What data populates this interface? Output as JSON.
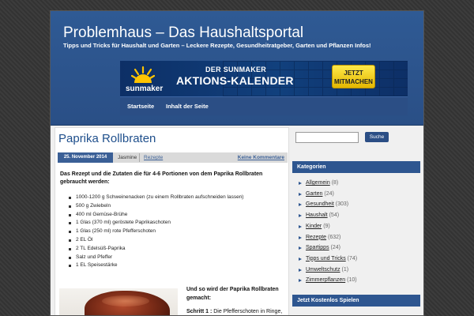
{
  "header": {
    "title": "Problemhaus – Das Haushaltsportal",
    "tagline": "Tipps und Tricks für Haushalt und Garten – Leckere Rezepte, Gesundheitratgeber, Garten und Pflanzen Infos!",
    "banner": {
      "brand": "sunmaker",
      "line1": "DER SUNMAKER",
      "line2": "AKTIONS-KALENDER",
      "cta_line1": "JETZT",
      "cta_line2": "MITMACHEN",
      "bg_color": "#11407d",
      "cta_color": "#ffd400"
    },
    "nav": [
      "Startseite",
      "Inhalt der Seite"
    ]
  },
  "post": {
    "title": "Paprika Rollbraten",
    "date": "25. November 2014",
    "author": "Jasmine",
    "category": "Rezepte",
    "comments": "Keine Kommentare",
    "intro": "Das Rezept und die Zutaten die für 4-6 Portionen von dem Paprika Rollbraten gebraucht werden:",
    "ingredients": [
      "1000-1200 g Schweinenacken (zu einem Rollbraten aufschneiden lassen)",
      "500 g Zwiebeln",
      "400 ml Gemüse-Brühe",
      "1 Glas (370 ml) geröstete Paprikaschoten",
      "1 Glas (250 ml) rote Pfefferschoten",
      "2 EL Öl",
      "2 TL Edelsüß-Paprika",
      "Salz und Pfeffer",
      "1 EL Speisestärke"
    ],
    "howto_heading": "Und so wird der Paprika Rollbraten gemacht:",
    "step1_label": "Schritt 1 :",
    "step1_text": "Die Pfefferschoten in Ringe, die Paprika in Stücke schneiden und die"
  },
  "sidebar": {
    "search_button": "Suche",
    "categories_title": "Kategorien",
    "categories": [
      {
        "name": "Allgemein",
        "count": "(8)"
      },
      {
        "name": "Garten",
        "count": "(24)"
      },
      {
        "name": "Gesundheit",
        "count": "(303)"
      },
      {
        "name": "Haushalt",
        "count": "(54)"
      },
      {
        "name": "Kinder",
        "count": "(9)"
      },
      {
        "name": "Rezepte",
        "count": "(632)"
      },
      {
        "name": "Spartipps",
        "count": "(24)"
      },
      {
        "name": "Tipps und Tricks",
        "count": "(74)"
      },
      {
        "name": "Umweltschutz",
        "count": "(1)"
      },
      {
        "name": "Zimmerpflanzen",
        "count": "(10)"
      }
    ],
    "games_title": "Jetzt Kostenlos Spielen"
  },
  "colors": {
    "header_blue": "#2f5a94",
    "accent_blue": "#2e5690",
    "title_blue": "#1f4f8c"
  }
}
